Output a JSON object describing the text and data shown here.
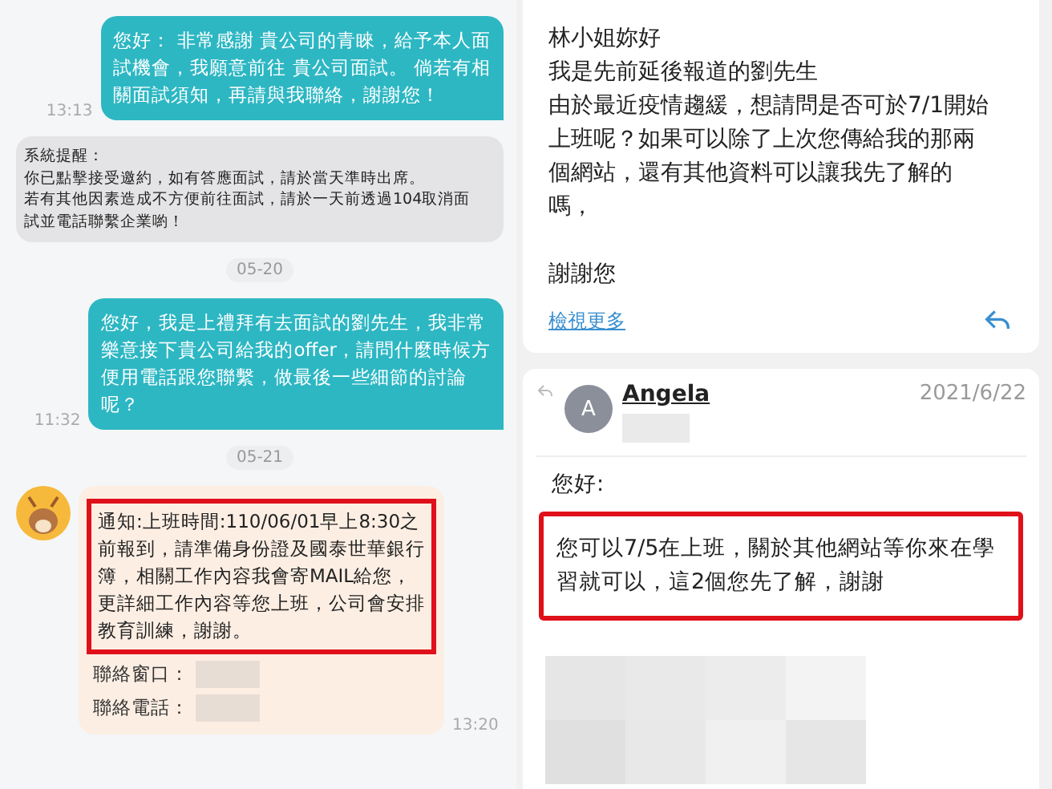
{
  "chat": {
    "messages": [
      {
        "kind": "sent",
        "lines": [
          "您好： 非常感謝 貴公司的青睞，給予本人面",
          "試機會，我願意前往 貴公司面試。 倘若有相",
          "關面試須知，再請與我聯絡，謝謝您！"
        ],
        "time": "13:13"
      },
      {
        "kind": "system",
        "lines": [
          "系統提醒：",
          "你已點擊接受邀約，如有答應面試，請於當天準時出席。",
          "若有其他因素造成不方便前往面試，請於一天前透過104取消面",
          "試並電話聯繫企業喲！"
        ]
      },
      {
        "kind": "date",
        "lines": [
          "05-20"
        ]
      },
      {
        "kind": "sent",
        "lines": [
          "您好，我是上禮拜有去面試的劉先生，我非常",
          "樂意接下貴公司給我的offer，請問什麼時候方",
          "便用電話跟您聯繫，做最後一些細節的討論",
          "呢？"
        ],
        "time": "11:32"
      },
      {
        "kind": "date",
        "lines": [
          "05-21"
        ]
      },
      {
        "kind": "received",
        "highlighted": true,
        "lines": [
          "通知:上班時間:110/06/01早上8:30之",
          "前報到，請準備身份證及國泰世華銀行",
          "簿，相關工作內容我會寄MAIL給您，",
          "更詳細工作內容等您上班，公司會安排",
          "教育訓練，謝謝。"
        ],
        "fields": [
          "聯絡窗口：",
          "聯絡電話："
        ],
        "time": "13:20"
      }
    ]
  },
  "mail": {
    "previous": {
      "lines": [
        "林小姐妳好",
        "我是先前延後報道的劉先生",
        "由於最近疫情趨緩，想請問是否可於7/1開始",
        "上班呢？如果可以除了上次您傳給我的那兩",
        "個網站，還有其他資料可以讓我先了解的",
        "嗎，"
      ],
      "closing": "謝謝您",
      "link": "檢視更多"
    },
    "reply": {
      "avatar": "A",
      "sender": "Angela",
      "date": "2021/6/22",
      "greeting": "您好:",
      "body": [
        "您可以7/5在上班，關於其他網站等你來在學",
        "習就可以，這2個您先了解，謝謝"
      ],
      "highlighted": true
    }
  }
}
